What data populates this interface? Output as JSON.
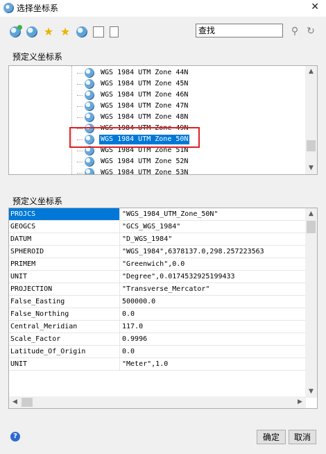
{
  "window": {
    "title": "选择坐标系",
    "close_glyph": "✕"
  },
  "toolbar": {
    "search_value": "查找",
    "icons": [
      "add-coord-system-icon",
      "edit-coord-system-icon",
      "add-favorite-icon",
      "favorite-icon",
      "coord-system-info-icon",
      "import-icon",
      "copy-icon"
    ]
  },
  "tree": {
    "label": "预定义坐标系",
    "items": [
      {
        "label": "WGS 1984 UTM Zone 44N",
        "selected": false
      },
      {
        "label": "WGS 1984 UTM Zone 45N",
        "selected": false
      },
      {
        "label": "WGS 1984 UTM Zone 46N",
        "selected": false
      },
      {
        "label": "WGS 1984 UTM Zone 47N",
        "selected": false
      },
      {
        "label": "WGS 1984 UTM Zone 48N",
        "selected": false
      },
      {
        "label": "WGS 1984 UTM Zone 49N",
        "selected": false
      },
      {
        "label": "WGS 1984 UTM Zone 50N",
        "selected": true
      },
      {
        "label": "WGS 1984 UTM Zone 51N",
        "selected": false
      },
      {
        "label": "WGS 1984 UTM Zone 52N",
        "selected": false
      },
      {
        "label": "WGS 1984 UTM Zone 53N",
        "selected": false
      }
    ]
  },
  "properties": {
    "label": "预定义坐标系",
    "rows": [
      {
        "name": "PROJCS",
        "value": "\"WGS_1984_UTM_Zone_50N\""
      },
      {
        "name": "GEOGCS",
        "value": "\"GCS_WGS_1984\""
      },
      {
        "name": "DATUM",
        "value": "\"D_WGS_1984\""
      },
      {
        "name": "SPHEROID",
        "value": "\"WGS_1984\",6378137.0,298.257223563"
      },
      {
        "name": "PRIMEM",
        "value": "\"Greenwich\",0.0"
      },
      {
        "name": "UNIT",
        "value": "\"Degree\",0.0174532925199433"
      },
      {
        "name": "PROJECTION",
        "value": "\"Transverse_Mercator\""
      },
      {
        "name": "False_Easting",
        "value": "500000.0"
      },
      {
        "name": "False_Northing",
        "value": "0.0"
      },
      {
        "name": "Central_Meridian",
        "value": "117.0"
      },
      {
        "name": "Scale_Factor",
        "value": "0.9996"
      },
      {
        "name": "Latitude_Of_Origin",
        "value": "0.0"
      },
      {
        "name": "UNIT",
        "value": "\"Meter\",1.0"
      }
    ]
  },
  "footer": {
    "ok_label": "确定",
    "cancel_label": "取消",
    "help_glyph": "?"
  }
}
